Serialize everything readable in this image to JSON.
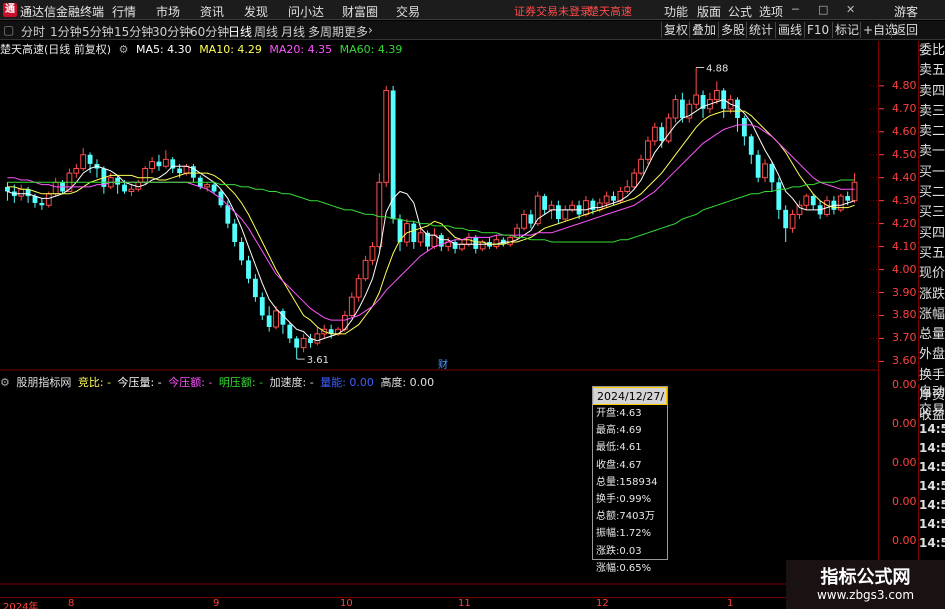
{
  "menubar": {
    "app_title": "通达信金融终端",
    "items": [
      "行情",
      "市场",
      "资讯",
      "发现",
      "问小达",
      "财富圈",
      "交易"
    ],
    "notice": "证券交易未登录",
    "stock_name": "楚天高速",
    "right_items": [
      "功能",
      "版面",
      "公式",
      "选项"
    ],
    "guest": "游客"
  },
  "toolbar": {
    "periods": [
      "分时",
      "1分钟",
      "5分钟",
      "15分钟",
      "30分钟",
      "60分钟",
      "日线",
      "周线",
      "月线",
      "多周期",
      "更多"
    ],
    "active_period": "日线",
    "right_buttons": [
      "复权",
      "叠加",
      "多股",
      "统计",
      "画线",
      "F10",
      "标记",
      "+自选",
      "返回"
    ]
  },
  "chart_header": {
    "title": "楚天高速(日线 前复权)",
    "ma5": "MA5: 4.30",
    "ma10": "MA10: 4.29",
    "ma20": "MA20: 4.35",
    "ma60": "MA60: 4.39"
  },
  "quote_panel": {
    "items": [
      "委比",
      "卖五",
      "卖四",
      "卖三",
      "卖二",
      "卖一",
      "买一",
      "买二",
      "买三",
      "买四",
      "买五",
      "现价",
      "涨跌",
      "涨幅",
      "总量",
      "外盘",
      "换手",
      "净资",
      "收益"
    ],
    "bottom_items": [
      "自动",
      "交易"
    ],
    "times": [
      "14:56",
      "14:56",
      "14:56",
      "14:56",
      "14:56",
      "14:56",
      "14:56"
    ]
  },
  "indicator_header": {
    "name": "股朋指标网",
    "jingbi": "竞比: -",
    "jinyaliang": "今压量: -",
    "jinyaer": "今压额: -",
    "mingyaer": "明压额: -",
    "jiasudu": "加速度: -",
    "lianglu": "量能: 0.00",
    "gaodu": "高度: 0.00"
  },
  "indicator_axis": [
    "0.00",
    "0.00",
    "0.00",
    "0.00",
    "0.00",
    "0.00"
  ],
  "info_box": {
    "date": "2024/12/27/五",
    "rows": [
      "开盘:4.63",
      "最高:4.69",
      "最低:4.61",
      "收盘:4.67",
      "总量:158934",
      "换手:0.99%",
      "总额:7403万",
      "振幅:1.72%",
      "涨跌:0.03",
      "涨幅:0.65%"
    ]
  },
  "time_axis": [
    "2024年",
    "8",
    "9",
    "10",
    "11",
    "12",
    "1"
  ],
  "watermark": {
    "line1": "指标公式网",
    "line2": "www.zbgs3.com"
  },
  "colors": {
    "up": "#ff4d4d",
    "down": "#54ffff",
    "ma5": "#ffffff",
    "ma10": "#ffff55",
    "ma20": "#ff55ff",
    "ma60": "#33dd33",
    "axis": "#ff4040"
  },
  "chart_data": {
    "type": "candlestick",
    "title": "楚天高速(日线 前复权)",
    "ylim": [
      3.58,
      4.93
    ],
    "y_ticks": [
      4.8,
      4.7,
      4.6,
      4.5,
      4.4,
      4.3,
      4.2,
      4.1,
      4.0,
      3.9,
      3.8,
      3.7,
      3.6
    ],
    "annotations": [
      {
        "label": "4.88",
        "value": 4.88
      },
      {
        "label": "3.61",
        "value": 3.61
      },
      {
        "label": "财",
        "value": null
      }
    ],
    "candles": [
      [
        4.36,
        4.34,
        4.38,
        4.3
      ],
      [
        4.34,
        4.32,
        4.37,
        4.29
      ],
      [
        4.32,
        4.35,
        4.37,
        4.3
      ],
      [
        4.35,
        4.32,
        4.36,
        4.29
      ],
      [
        4.32,
        4.29,
        4.33,
        4.27
      ],
      [
        4.29,
        4.28,
        4.31,
        4.26
      ],
      [
        4.28,
        4.33,
        4.34,
        4.27
      ],
      [
        4.33,
        4.38,
        4.4,
        4.32
      ],
      [
        4.38,
        4.34,
        4.39,
        4.33
      ],
      [
        4.34,
        4.42,
        4.44,
        4.34
      ],
      [
        4.42,
        4.44,
        4.46,
        4.4
      ],
      [
        4.44,
        4.5,
        4.53,
        4.43
      ],
      [
        4.5,
        4.46,
        4.51,
        4.42
      ],
      [
        4.46,
        4.44,
        4.48,
        4.4
      ],
      [
        4.44,
        4.36,
        4.45,
        4.33
      ],
      [
        4.36,
        4.4,
        4.42,
        4.35
      ],
      [
        4.4,
        4.37,
        4.41,
        4.33
      ],
      [
        4.37,
        4.34,
        4.39,
        4.33
      ],
      [
        4.34,
        4.35,
        4.37,
        4.32
      ],
      [
        4.35,
        4.38,
        4.39,
        4.34
      ],
      [
        4.38,
        4.44,
        4.45,
        4.37
      ],
      [
        4.44,
        4.47,
        4.49,
        4.42
      ],
      [
        4.47,
        4.45,
        4.5,
        4.43
      ],
      [
        4.45,
        4.48,
        4.52,
        4.44
      ],
      [
        4.48,
        4.44,
        4.49,
        4.42
      ],
      [
        4.44,
        4.42,
        4.46,
        4.4
      ],
      [
        4.42,
        4.45,
        4.46,
        4.41
      ],
      [
        4.45,
        4.4,
        4.46,
        4.38
      ],
      [
        4.4,
        4.36,
        4.41,
        4.35
      ],
      [
        4.36,
        4.37,
        4.38,
        4.34
      ],
      [
        4.37,
        4.34,
        4.38,
        4.33
      ],
      [
        4.34,
        4.28,
        4.35,
        4.27
      ],
      [
        4.28,
        4.2,
        4.3,
        4.18
      ],
      [
        4.2,
        4.12,
        4.22,
        4.1
      ],
      [
        4.12,
        4.04,
        4.14,
        4.02
      ],
      [
        4.04,
        3.96,
        4.06,
        3.94
      ],
      [
        3.96,
        3.88,
        3.98,
        3.86
      ],
      [
        3.88,
        3.8,
        3.9,
        3.78
      ],
      [
        3.8,
        3.75,
        3.84,
        3.73
      ],
      [
        3.75,
        3.82,
        3.84,
        3.74
      ],
      [
        3.82,
        3.76,
        3.83,
        3.72
      ],
      [
        3.76,
        3.7,
        3.77,
        3.68
      ],
      [
        3.7,
        3.66,
        3.71,
        3.61
      ],
      [
        3.66,
        3.7,
        3.72,
        3.64
      ],
      [
        3.7,
        3.68,
        3.72,
        3.66
      ],
      [
        3.68,
        3.72,
        3.75,
        3.67
      ],
      [
        3.72,
        3.74,
        3.76,
        3.7
      ],
      [
        3.74,
        3.72,
        3.76,
        3.7
      ],
      [
        3.72,
        3.74,
        3.75,
        3.71
      ],
      [
        3.74,
        3.8,
        3.82,
        3.73
      ],
      [
        3.8,
        3.88,
        3.9,
        3.79
      ],
      [
        3.88,
        3.96,
        3.98,
        3.86
      ],
      [
        3.96,
        4.04,
        4.06,
        3.95
      ],
      [
        4.04,
        4.1,
        4.12,
        4.02
      ],
      [
        4.1,
        4.38,
        4.42,
        4.09
      ],
      [
        4.38,
        4.78,
        4.8,
        4.36
      ],
      [
        4.78,
        4.22,
        4.8,
        4.2
      ],
      [
        4.22,
        4.12,
        4.24,
        4.08
      ],
      [
        4.12,
        4.2,
        4.22,
        4.1
      ],
      [
        4.2,
        4.12,
        4.21,
        4.09
      ],
      [
        4.12,
        4.16,
        4.18,
        4.1
      ],
      [
        4.16,
        4.1,
        4.17,
        4.08
      ],
      [
        4.1,
        4.15,
        4.18,
        4.09
      ],
      [
        4.15,
        4.1,
        4.16,
        4.08
      ],
      [
        4.1,
        4.12,
        4.14,
        4.08
      ],
      [
        4.12,
        4.09,
        4.13,
        4.07
      ],
      [
        4.09,
        4.11,
        4.13,
        4.08
      ],
      [
        4.11,
        4.14,
        4.16,
        4.1
      ],
      [
        4.14,
        4.09,
        4.15,
        4.07
      ],
      [
        4.09,
        4.12,
        4.13,
        4.08
      ],
      [
        4.12,
        4.1,
        4.14,
        4.09
      ],
      [
        4.1,
        4.13,
        4.15,
        4.09
      ],
      [
        4.13,
        4.11,
        4.14,
        4.1
      ],
      [
        4.11,
        4.14,
        4.15,
        4.1
      ],
      [
        4.14,
        4.18,
        4.2,
        4.13
      ],
      [
        4.18,
        4.24,
        4.26,
        4.17
      ],
      [
        4.24,
        4.2,
        4.26,
        4.18
      ],
      [
        4.2,
        4.32,
        4.34,
        4.19
      ],
      [
        4.32,
        4.26,
        4.33,
        4.24
      ],
      [
        4.26,
        4.28,
        4.3,
        4.22
      ],
      [
        4.28,
        4.22,
        4.3,
        4.2
      ],
      [
        4.22,
        4.26,
        4.28,
        4.21
      ],
      [
        4.26,
        4.28,
        4.3,
        4.25
      ],
      [
        4.28,
        4.24,
        4.3,
        4.22
      ],
      [
        4.24,
        4.3,
        4.32,
        4.23
      ],
      [
        4.3,
        4.26,
        4.31,
        4.24
      ],
      [
        4.26,
        4.29,
        4.31,
        4.25
      ],
      [
        4.29,
        4.32,
        4.34,
        4.27
      ],
      [
        4.32,
        4.3,
        4.34,
        4.28
      ],
      [
        4.3,
        4.34,
        4.36,
        4.29
      ],
      [
        4.34,
        4.36,
        4.39,
        4.33
      ],
      [
        4.36,
        4.42,
        4.44,
        4.35
      ],
      [
        4.42,
        4.48,
        4.5,
        4.41
      ],
      [
        4.48,
        4.56,
        4.58,
        4.46
      ],
      [
        4.56,
        4.62,
        4.64,
        4.54
      ],
      [
        4.62,
        4.56,
        4.64,
        4.53
      ],
      [
        4.56,
        4.66,
        4.68,
        4.55
      ],
      [
        4.66,
        4.74,
        4.76,
        4.64
      ],
      [
        4.74,
        4.66,
        4.77,
        4.64
      ],
      [
        4.66,
        4.72,
        4.74,
        4.64
      ],
      [
        4.72,
        4.76,
        4.88,
        4.7
      ],
      [
        4.76,
        4.7,
        4.78,
        4.66
      ],
      [
        4.7,
        4.74,
        4.77,
        4.68
      ],
      [
        4.74,
        4.78,
        4.82,
        4.72
      ],
      [
        4.78,
        4.7,
        4.79,
        4.66
      ],
      [
        4.7,
        4.74,
        4.76,
        4.68
      ],
      [
        4.74,
        4.66,
        4.75,
        4.6
      ],
      [
        4.66,
        4.58,
        4.67,
        4.54
      ],
      [
        4.58,
        4.5,
        4.59,
        4.46
      ],
      [
        4.5,
        4.4,
        4.52,
        4.38
      ],
      [
        4.4,
        4.46,
        4.48,
        4.38
      ],
      [
        4.46,
        4.38,
        4.47,
        4.34
      ],
      [
        4.38,
        4.26,
        4.4,
        4.22
      ],
      [
        4.26,
        4.18,
        4.28,
        4.12
      ],
      [
        4.18,
        4.24,
        4.26,
        4.16
      ],
      [
        4.24,
        4.28,
        4.3,
        4.22
      ],
      [
        4.28,
        4.32,
        4.33,
        4.26
      ],
      [
        4.32,
        4.28,
        4.33,
        4.26
      ],
      [
        4.28,
        4.24,
        4.3,
        4.22
      ],
      [
        4.24,
        4.3,
        4.32,
        4.23
      ],
      [
        4.3,
        4.26,
        4.32,
        4.24
      ],
      [
        4.26,
        4.32,
        4.33,
        4.25
      ],
      [
        4.32,
        4.3,
        4.34,
        4.28
      ],
      [
        4.3,
        4.38,
        4.42,
        4.29
      ]
    ],
    "series": [
      {
        "name": "MA5",
        "values": [
          4.34,
          4.33,
          4.33,
          4.33,
          4.32,
          4.31,
          4.31,
          4.32,
          4.33,
          4.35,
          4.38,
          4.42,
          4.44,
          4.45,
          4.44,
          4.43,
          4.41,
          4.38,
          4.37,
          4.36,
          4.37,
          4.39,
          4.4,
          4.42,
          4.45,
          4.45,
          4.45,
          4.44,
          4.42,
          4.4,
          4.38,
          4.35,
          4.31,
          4.25,
          4.18,
          4.1,
          4.02,
          3.94,
          3.87,
          3.83,
          3.8,
          3.77,
          3.74,
          3.73,
          3.7,
          3.69,
          3.7,
          3.71,
          3.72,
          3.74,
          3.78,
          3.83,
          3.89,
          3.96,
          4.07,
          4.25,
          4.31,
          4.34,
          4.33,
          4.29,
          4.18,
          4.15,
          4.15,
          4.13,
          4.13,
          4.11,
          4.11,
          4.11,
          4.11,
          4.11,
          4.11,
          4.11,
          4.12,
          4.12,
          4.13,
          4.15,
          4.17,
          4.22,
          4.24,
          4.26,
          4.26,
          4.26,
          4.26,
          4.26,
          4.26,
          4.27,
          4.27,
          4.28,
          4.29,
          4.3,
          4.32,
          4.35,
          4.39,
          4.45,
          4.51,
          4.55,
          4.59,
          4.63,
          4.66,
          4.67,
          4.69,
          4.71,
          4.72,
          4.73,
          4.74,
          4.72,
          4.71,
          4.68,
          4.64,
          4.58,
          4.52,
          4.47,
          4.41,
          4.34,
          4.31,
          4.27,
          4.26,
          4.26,
          4.26,
          4.27,
          4.28,
          4.28,
          4.29,
          4.3
        ]
      },
      {
        "name": "MA10",
        "values": [
          4.36,
          4.36,
          4.35,
          4.35,
          4.34,
          4.33,
          4.33,
          4.33,
          4.33,
          4.33,
          4.34,
          4.36,
          4.38,
          4.39,
          4.4,
          4.41,
          4.41,
          4.41,
          4.41,
          4.4,
          4.4,
          4.4,
          4.39,
          4.39,
          4.4,
          4.41,
          4.42,
          4.42,
          4.42,
          4.42,
          4.41,
          4.39,
          4.36,
          4.33,
          4.29,
          4.24,
          4.18,
          4.12,
          4.06,
          4.0,
          3.95,
          3.9,
          3.85,
          3.8,
          3.78,
          3.75,
          3.73,
          3.72,
          3.72,
          3.72,
          3.74,
          3.76,
          3.8,
          3.84,
          3.9,
          3.99,
          4.07,
          4.13,
          4.16,
          4.17,
          4.18,
          4.19,
          4.21,
          4.2,
          4.17,
          4.14,
          4.13,
          4.13,
          4.12,
          4.12,
          4.11,
          4.11,
          4.11,
          4.12,
          4.12,
          4.13,
          4.14,
          4.16,
          4.18,
          4.19,
          4.2,
          4.21,
          4.22,
          4.23,
          4.24,
          4.25,
          4.26,
          4.27,
          4.28,
          4.29,
          4.3,
          4.31,
          4.33,
          4.36,
          4.39,
          4.42,
          4.46,
          4.5,
          4.54,
          4.58,
          4.62,
          4.65,
          4.67,
          4.68,
          4.69,
          4.69,
          4.69,
          4.69,
          4.67,
          4.64,
          4.61,
          4.58,
          4.55,
          4.51,
          4.46,
          4.41,
          4.37,
          4.33,
          4.3,
          4.28,
          4.27,
          4.27,
          4.27,
          4.28
        ]
      },
      {
        "name": "MA20",
        "values": [
          4.4,
          4.4,
          4.39,
          4.39,
          4.38,
          4.37,
          4.37,
          4.36,
          4.36,
          4.36,
          4.36,
          4.36,
          4.36,
          4.37,
          4.37,
          4.38,
          4.38,
          4.38,
          4.38,
          4.38,
          4.38,
          4.38,
          4.38,
          4.38,
          4.38,
          4.38,
          4.38,
          4.37,
          4.36,
          4.35,
          4.33,
          4.31,
          4.28,
          4.25,
          4.22,
          4.18,
          4.13,
          4.08,
          4.03,
          3.98,
          3.95,
          3.92,
          3.89,
          3.86,
          3.83,
          3.81,
          3.79,
          3.78,
          3.78,
          3.78,
          3.79,
          3.8,
          3.82,
          3.84,
          3.87,
          3.91,
          3.94,
          3.97,
          4.0,
          4.03,
          4.06,
          4.08,
          4.1,
          4.11,
          4.12,
          4.13,
          4.13,
          4.14,
          4.14,
          4.14,
          4.14,
          4.15,
          4.15,
          4.15,
          4.15,
          4.15,
          4.15,
          4.16,
          4.16,
          4.16,
          4.17,
          4.18,
          4.19,
          4.2,
          4.21,
          4.22,
          4.23,
          4.24,
          4.25,
          4.26,
          4.27,
          4.28,
          4.3,
          4.32,
          4.34,
          4.37,
          4.4,
          4.43,
          4.46,
          4.49,
          4.52,
          4.55,
          4.57,
          4.59,
          4.61,
          4.62,
          4.63,
          4.63,
          4.63,
          4.62,
          4.6,
          4.58,
          4.55,
          4.52,
          4.49,
          4.46,
          4.43,
          4.4,
          4.38,
          4.37,
          4.36,
          4.35,
          4.35,
          4.35
        ]
      },
      {
        "name": "MA60",
        "values": [
          4.38,
          4.38,
          4.38,
          4.38,
          4.38,
          4.38,
          4.38,
          4.38,
          4.38,
          4.38,
          4.38,
          4.38,
          4.38,
          4.38,
          4.38,
          4.38,
          4.38,
          4.38,
          4.38,
          4.38,
          4.38,
          4.38,
          4.38,
          4.38,
          4.38,
          4.38,
          4.38,
          4.38,
          4.38,
          4.38,
          4.38,
          4.37,
          4.37,
          4.37,
          4.36,
          4.36,
          4.35,
          4.35,
          4.34,
          4.34,
          4.33,
          4.33,
          4.32,
          4.31,
          4.3,
          4.3,
          4.29,
          4.28,
          4.27,
          4.26,
          4.26,
          4.25,
          4.24,
          4.24,
          4.23,
          4.23,
          4.22,
          4.22,
          4.21,
          4.21,
          4.2,
          4.2,
          4.19,
          4.19,
          4.19,
          4.18,
          4.18,
          4.17,
          4.17,
          4.16,
          4.16,
          4.16,
          4.15,
          4.15,
          4.14,
          4.14,
          4.13,
          4.13,
          4.13,
          4.12,
          4.12,
          4.12,
          4.12,
          4.12,
          4.12,
          4.12,
          4.12,
          4.12,
          4.12,
          4.13,
          4.13,
          4.14,
          4.15,
          4.16,
          4.17,
          4.18,
          4.19,
          4.2,
          4.22,
          4.23,
          4.24,
          4.26,
          4.27,
          4.28,
          4.29,
          4.3,
          4.31,
          4.32,
          4.33,
          4.33,
          4.34,
          4.34,
          4.35,
          4.35,
          4.36,
          4.36,
          4.37,
          4.37,
          4.38,
          4.38,
          4.38,
          4.39,
          4.39,
          4.39
        ]
      }
    ]
  }
}
